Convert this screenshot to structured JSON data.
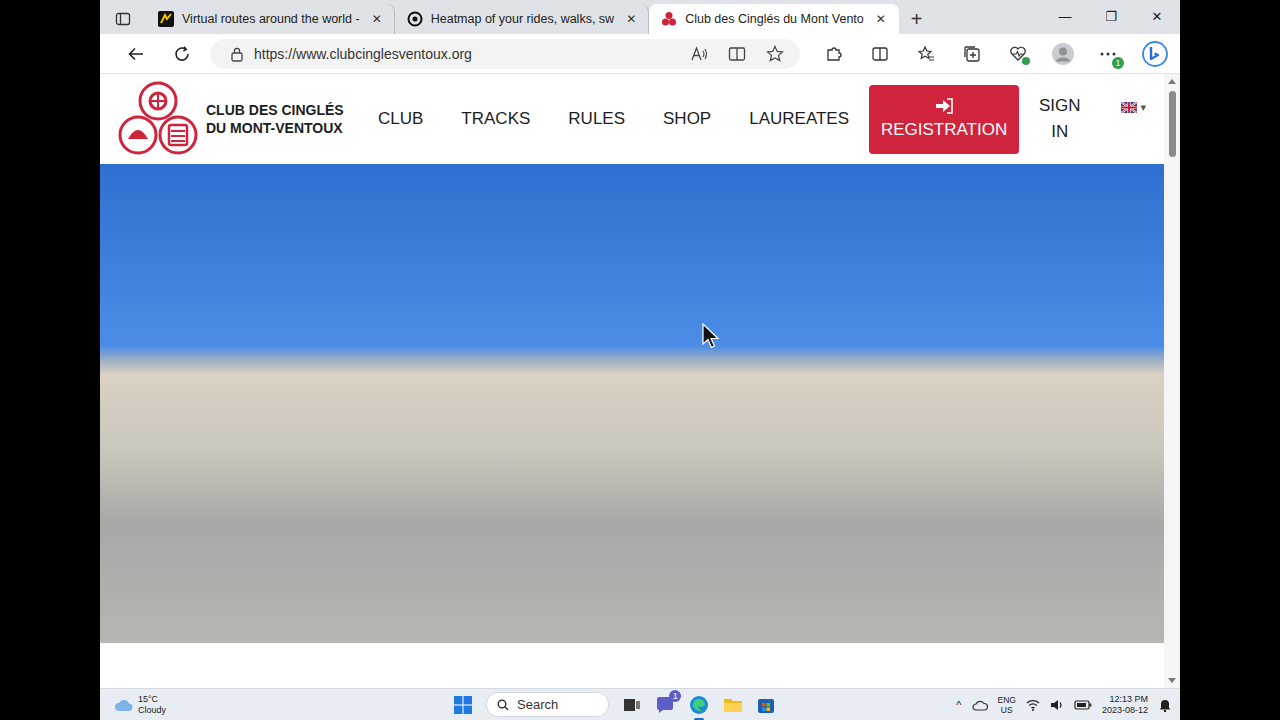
{
  "browser": {
    "tabs": [
      {
        "label": "Virtual routes around the world -",
        "selected": false
      },
      {
        "label": "Heatmap of your rides, walks, sw",
        "selected": false
      },
      {
        "label": "Club des Cinglés du Mont Vento",
        "selected": true
      }
    ],
    "tab_close": "✕",
    "new_tab": "+",
    "window_controls": [
      "—",
      "❐",
      "✕"
    ],
    "address": "https://www.clubcinglesventoux.org",
    "extension_badge": "1"
  },
  "site": {
    "logo_lines": [
      "CLUB DES CINGLÉS",
      "DU MONT-VENTOUX"
    ],
    "nav": [
      "CLUB",
      "TRACKS",
      "RULES",
      "SHOP",
      "LAUREATES"
    ],
    "registration": "REGISTRATION",
    "sign_in_lines": [
      "SIGN",
      "IN"
    ],
    "language_caret": "▾"
  },
  "taskbar": {
    "weather": {
      "temp": "15°C",
      "condition": "Cloudy"
    },
    "search": "Search",
    "chat_badge": "1",
    "tray_chevron": "^",
    "language": [
      "ENG",
      "US"
    ],
    "time": "12:13 PM",
    "date": "2023-08-12"
  }
}
